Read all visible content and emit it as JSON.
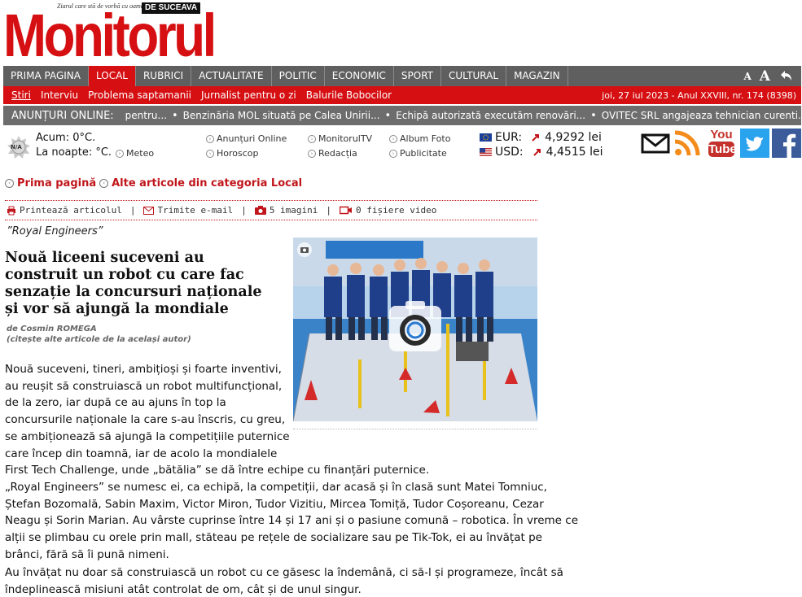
{
  "logo": {
    "tagline": "Ziarul care stă de vorbă cu oamenii",
    "brand": "Monitorul",
    "edition": "DE SUCEAVA"
  },
  "nav": {
    "items": [
      "PRIMA PAGINA",
      "LOCAL",
      "RUBRICI",
      "ACTUALITATE",
      "POLITIC",
      "ECONOMIC",
      "SPORT",
      "CULTURAL",
      "MAGAZIN"
    ],
    "active": "LOCAL",
    "font_small": "A",
    "font_large": "A"
  },
  "subnav": {
    "items": [
      "Stiri",
      "Interviu",
      "Problema saptamanii",
      "Jurnalist pentru o zi",
      "Balurile Bobocilor"
    ],
    "date": "joi, 27 iul 2023 - Anul XXVIII, nr. 174 (8398)"
  },
  "ticker": {
    "label": "ANUNȚURI ONLINE:",
    "items": [
      "pentru...",
      "Benzinăria MOL situată pe Calea Unirii...",
      "Echipă autorizată executăm renovări...",
      "OVITEC SRL angajeaza tehnician curenti..."
    ]
  },
  "weather": {
    "icon_text": "N/A",
    "now": "Acum: 0°C.",
    "night": "La noapte: °C.",
    "meteo": "Meteo"
  },
  "links": {
    "col1": [
      "Anunțuri Online",
      "Horoscop"
    ],
    "col2": [
      "MonitorulTV",
      "Redacția"
    ],
    "col3": [
      "Album Foto",
      "Publicitate"
    ]
  },
  "currency": {
    "eur_label": "EUR:",
    "eur_value": "4,9292 lei",
    "usd_label": "USD:",
    "usd_value": "4,4515 lei",
    "trend_color": "#c0161b"
  },
  "social": [
    "email-icon",
    "rss-icon",
    "youtube-icon",
    "twitter-icon",
    "facebook-icon"
  ],
  "social_youtube_text": [
    "You",
    "Tube"
  ],
  "breadcrumbs": {
    "home": "Prima pagină",
    "category": "Alte articole din categoria Local"
  },
  "tools": {
    "print": "Printează articolul",
    "email": "Trimite e-mail",
    "images": "5 imagini",
    "video": "0 fișiere video"
  },
  "article": {
    "kicker": "”Royal Engineers”",
    "title": "Nouă liceeni suceveni au construit un robot cu care fac senzație la concursuri naționale și vor să ajungă la mondiale",
    "author_prefix": "de",
    "author": "Cosmin ROMEGA",
    "author_more": "(citește alte articole de la același autor)",
    "intro_lines": [
      "Nouă suceveni, tineri, ambițioși și foarte inventivi,",
      "au reușit să construiască un robot multifuncțional,",
      "de la zero, iar după ce au ajuns în top la",
      "concursurile naționale la care s-au înscris, cu greu,",
      "se ambiționează să ajungă la competițiile puternice",
      "care încep din toamnă, iar de acolo la mondialele",
      "First Tech Challenge, unde „bătălia” se dă între echipe cu finanțări puternice."
    ],
    "para2_lines": [
      "„Royal Engineers” se numesc ei, ca echipă, la competiții, dar acasă și în clasă sunt Matei Tomniuc,",
      "Ștefan Bozomală, Sabin Maxim, Victor Miron, Tudor Vizitiu, Mircea Tomiță, Tudor Coșoreanu, Cezar",
      "Neagu și Sorin Marian. Au vârste cuprinse între 14 și 17 ani și o pasiune comună – robotica. În vreme ce",
      "alții se plimbau cu orele prin mall, stăteau pe rețele de socializare sau pe Tik-Tok, ei au învățat pe",
      "brânci, fără să îi pună nimeni."
    ],
    "para3_lines": [
      "Au învățat nu doar să construiască un robot cu ce găsesc la îndemână, ci să-l și programeze, încât să",
      "îndeplinească misiuni atât controlat de om, cât și de unul singur."
    ]
  },
  "colors": {
    "brand_red": "#d50f12",
    "nav_gray": "#5f5f5f",
    "ticker_gray": "#6d6d6d",
    "link_red": "#c0161b"
  }
}
